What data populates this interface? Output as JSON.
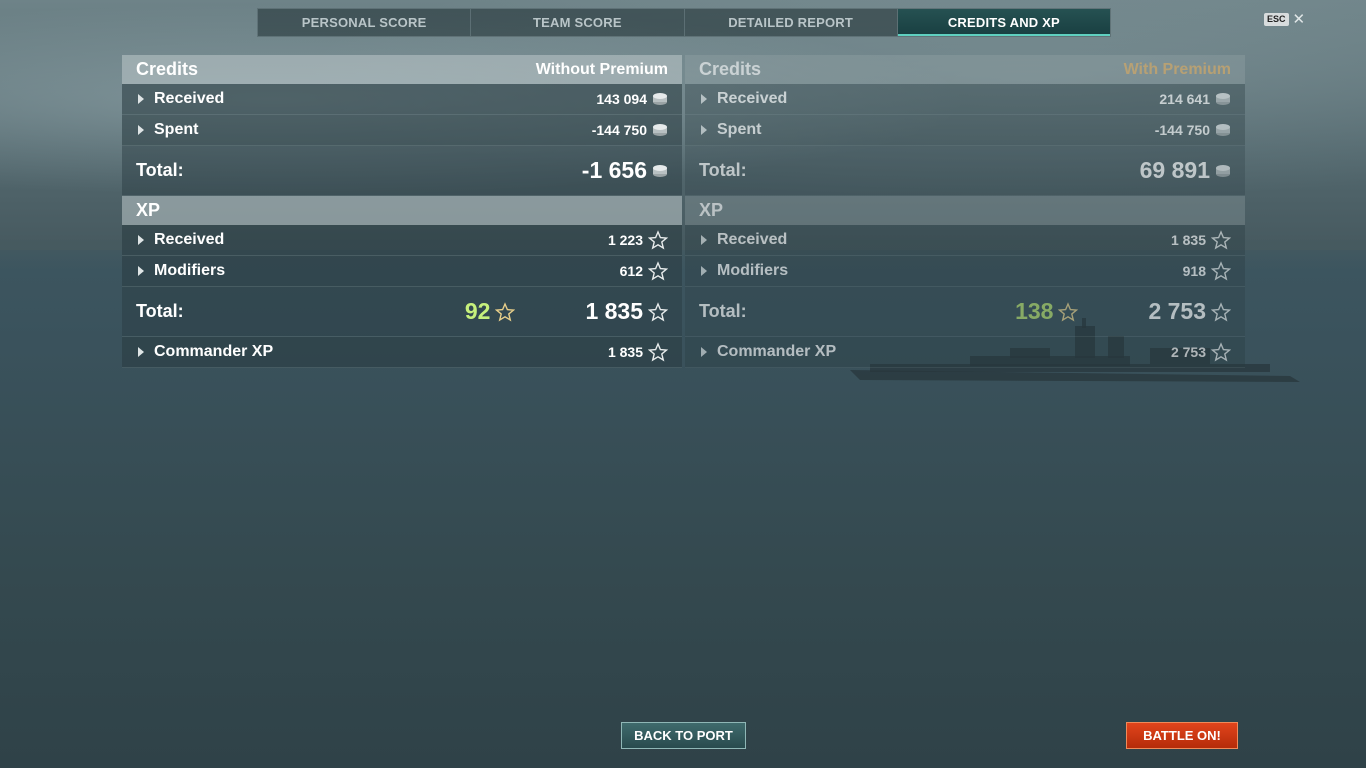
{
  "tabs": [
    {
      "label": "PERSONAL SCORE",
      "active": false
    },
    {
      "label": "TEAM SCORE",
      "active": false
    },
    {
      "label": "DETAILED REPORT",
      "active": false
    },
    {
      "label": "CREDITS AND XP",
      "active": true
    }
  ],
  "esc": {
    "key": "ESC",
    "close": "✕"
  },
  "left": {
    "credits_title": "Credits",
    "mode": "Without Premium",
    "received_label": "Received",
    "received_value": "143 094",
    "spent_label": "Spent",
    "spent_value": "-144 750",
    "credits_total_label": "Total:",
    "credits_total_value": "-1 656",
    "xp_title": "XP",
    "xp_received_label": "Received",
    "xp_received_value": "1 223",
    "modifiers_label": "Modifiers",
    "modifiers_value": "612",
    "xp_total_label": "Total:",
    "xp_free_value": "92",
    "xp_total_value": "1 835",
    "commander_label": "Commander XP",
    "commander_value": "1 835"
  },
  "right": {
    "credits_title": "Credits",
    "mode": "With Premium",
    "received_label": "Received",
    "received_value": "214 641",
    "spent_label": "Spent",
    "spent_value": "-144 750",
    "credits_total_label": "Total:",
    "credits_total_value": "69 891",
    "xp_title": "XP",
    "xp_received_label": "Received",
    "xp_received_value": "1 835",
    "modifiers_label": "Modifiers",
    "modifiers_value": "918",
    "xp_total_label": "Total:",
    "xp_free_value": "138",
    "xp_total_value": "2 753",
    "commander_label": "Commander XP",
    "commander_value": "2 753"
  },
  "buttons": {
    "back_to_port": "BACK TO PORT",
    "battle_on": "BATTLE ON!"
  },
  "colors": {
    "premium": "#e3b267",
    "free_xp": "#c6f07c",
    "battle_button": "#d03a12",
    "active_tab": "#1e5050"
  }
}
